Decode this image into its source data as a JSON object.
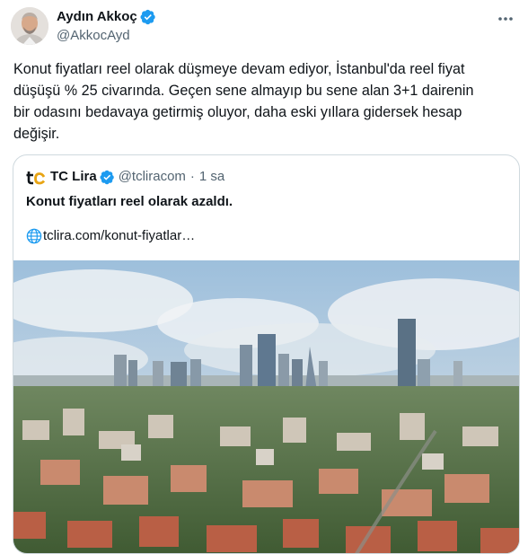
{
  "author": {
    "name": "Aydın Akkoç",
    "handle": "@AkkocAyd"
  },
  "tweet": {
    "text": "Konut fiyatları reel olarak düşmeye devam ediyor, İstanbul'da reel fiyat\ndüşüşü % 25 civarında. Geçen sene almayıp bu sene alan 3+1 dairenin\nbir odasını bedavaya getirmiş oluyor, daha eski yıllara gidersek hesap\ndeğişir."
  },
  "quoted": {
    "name": "TC Lira",
    "handle": "@tcliracom",
    "separator": "·",
    "time": "1 sa",
    "title": "Konut fiyatları reel olarak azaldı.",
    "link": "tclira.com/konut-fiyatlar…"
  },
  "icons": {
    "verified": "verified-badge-icon",
    "more": "more-options-icon",
    "globe": "globe-icon",
    "logo": "tclira-logo"
  },
  "colors": {
    "verified_blue": "#1d9bf0",
    "secondary_text": "#536471",
    "border": "#cfd9de"
  }
}
